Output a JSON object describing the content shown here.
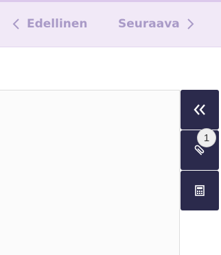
{
  "nav": {
    "prev_label": "Edellinen",
    "next_label": "Seuraava"
  },
  "side_panel": {
    "attachment_count": "1",
    "icons": [
      "double-chevron-left-icon",
      "paperclip-icon",
      "calculator-icon"
    ]
  },
  "colors": {
    "topbar_bg": "#f1e9f7",
    "nav_text": "#a99ac7",
    "panel_bg": "#2b2a4c"
  }
}
